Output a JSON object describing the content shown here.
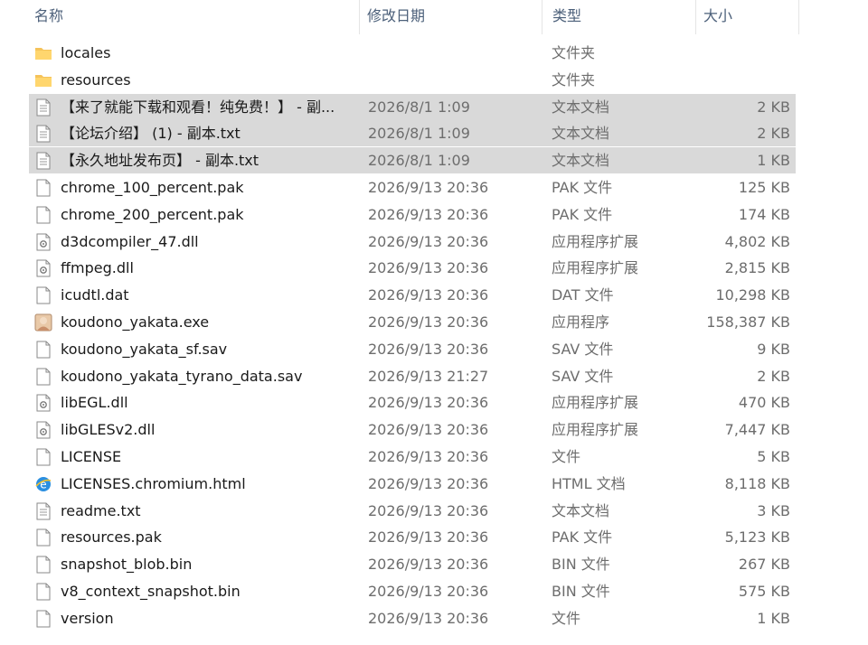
{
  "columns": {
    "name": "名称",
    "date": "修改日期",
    "type": "类型",
    "size": "大小"
  },
  "colors": {
    "selected_row": "#d9d9d9",
    "header_text": "#4c607a",
    "folder": "#f5c35a"
  },
  "files": [
    {
      "icon": "folder-icon",
      "name": "locales",
      "date": "",
      "type": "文件夹",
      "size": "",
      "selected": false
    },
    {
      "icon": "folder-icon",
      "name": "resources",
      "date": "",
      "type": "文件夹",
      "size": "",
      "selected": false
    },
    {
      "icon": "text-file-icon",
      "name": "【来了就能下载和观看！纯免费！】 - 副...",
      "date": "2026/8/1 1:09",
      "type": "文本文档",
      "size": "2 KB",
      "selected": true
    },
    {
      "icon": "text-file-icon",
      "name": "【论坛介绍】 (1) - 副本.txt",
      "date": "2026/8/1 1:09",
      "type": "文本文档",
      "size": "2 KB",
      "selected": true
    },
    {
      "icon": "text-file-icon",
      "name": "【永久地址发布页】 - 副本.txt",
      "date": "2026/8/1 1:09",
      "type": "文本文档",
      "size": "1 KB",
      "selected": true
    },
    {
      "icon": "file-icon",
      "name": "chrome_100_percent.pak",
      "date": "2026/9/13 20:36",
      "type": "PAK 文件",
      "size": "125 KB",
      "selected": false
    },
    {
      "icon": "file-icon",
      "name": "chrome_200_percent.pak",
      "date": "2026/9/13 20:36",
      "type": "PAK 文件",
      "size": "174 KB",
      "selected": false
    },
    {
      "icon": "dll-icon",
      "name": "d3dcompiler_47.dll",
      "date": "2026/9/13 20:36",
      "type": "应用程序扩展",
      "size": "4,802 KB",
      "selected": false
    },
    {
      "icon": "dll-icon",
      "name": "ffmpeg.dll",
      "date": "2026/9/13 20:36",
      "type": "应用程序扩展",
      "size": "2,815 KB",
      "selected": false
    },
    {
      "icon": "file-icon",
      "name": "icudtl.dat",
      "date": "2026/9/13 20:36",
      "type": "DAT 文件",
      "size": "10,298 KB",
      "selected": false
    },
    {
      "icon": "app-icon",
      "name": "koudono_yakata.exe",
      "date": "2026/9/13 20:36",
      "type": "应用程序",
      "size": "158,387 KB",
      "selected": false
    },
    {
      "icon": "file-icon",
      "name": "koudono_yakata_sf.sav",
      "date": "2026/9/13 20:36",
      "type": "SAV 文件",
      "size": "9 KB",
      "selected": false
    },
    {
      "icon": "file-icon",
      "name": "koudono_yakata_tyrano_data.sav",
      "date": "2026/9/13 21:27",
      "type": "SAV 文件",
      "size": "2 KB",
      "selected": false
    },
    {
      "icon": "dll-icon",
      "name": "libEGL.dll",
      "date": "2026/9/13 20:36",
      "type": "应用程序扩展",
      "size": "470 KB",
      "selected": false
    },
    {
      "icon": "dll-icon",
      "name": "libGLESv2.dll",
      "date": "2026/9/13 20:36",
      "type": "应用程序扩展",
      "size": "7,447 KB",
      "selected": false
    },
    {
      "icon": "file-icon",
      "name": "LICENSE",
      "date": "2026/9/13 20:36",
      "type": "文件",
      "size": "5 KB",
      "selected": false
    },
    {
      "icon": "html-icon",
      "name": "LICENSES.chromium.html",
      "date": "2026/9/13 20:36",
      "type": "HTML 文档",
      "size": "8,118 KB",
      "selected": false
    },
    {
      "icon": "text-file-icon",
      "name": "readme.txt",
      "date": "2026/9/13 20:36",
      "type": "文本文档",
      "size": "3 KB",
      "selected": false
    },
    {
      "icon": "file-icon",
      "name": "resources.pak",
      "date": "2026/9/13 20:36",
      "type": "PAK 文件",
      "size": "5,123 KB",
      "selected": false
    },
    {
      "icon": "file-icon",
      "name": "snapshot_blob.bin",
      "date": "2026/9/13 20:36",
      "type": "BIN 文件",
      "size": "267 KB",
      "selected": false
    },
    {
      "icon": "file-icon",
      "name": "v8_context_snapshot.bin",
      "date": "2026/9/13 20:36",
      "type": "BIN 文件",
      "size": "575 KB",
      "selected": false
    },
    {
      "icon": "file-icon",
      "name": "version",
      "date": "2026/9/13 20:36",
      "type": "文件",
      "size": "1 KB",
      "selected": false
    }
  ]
}
